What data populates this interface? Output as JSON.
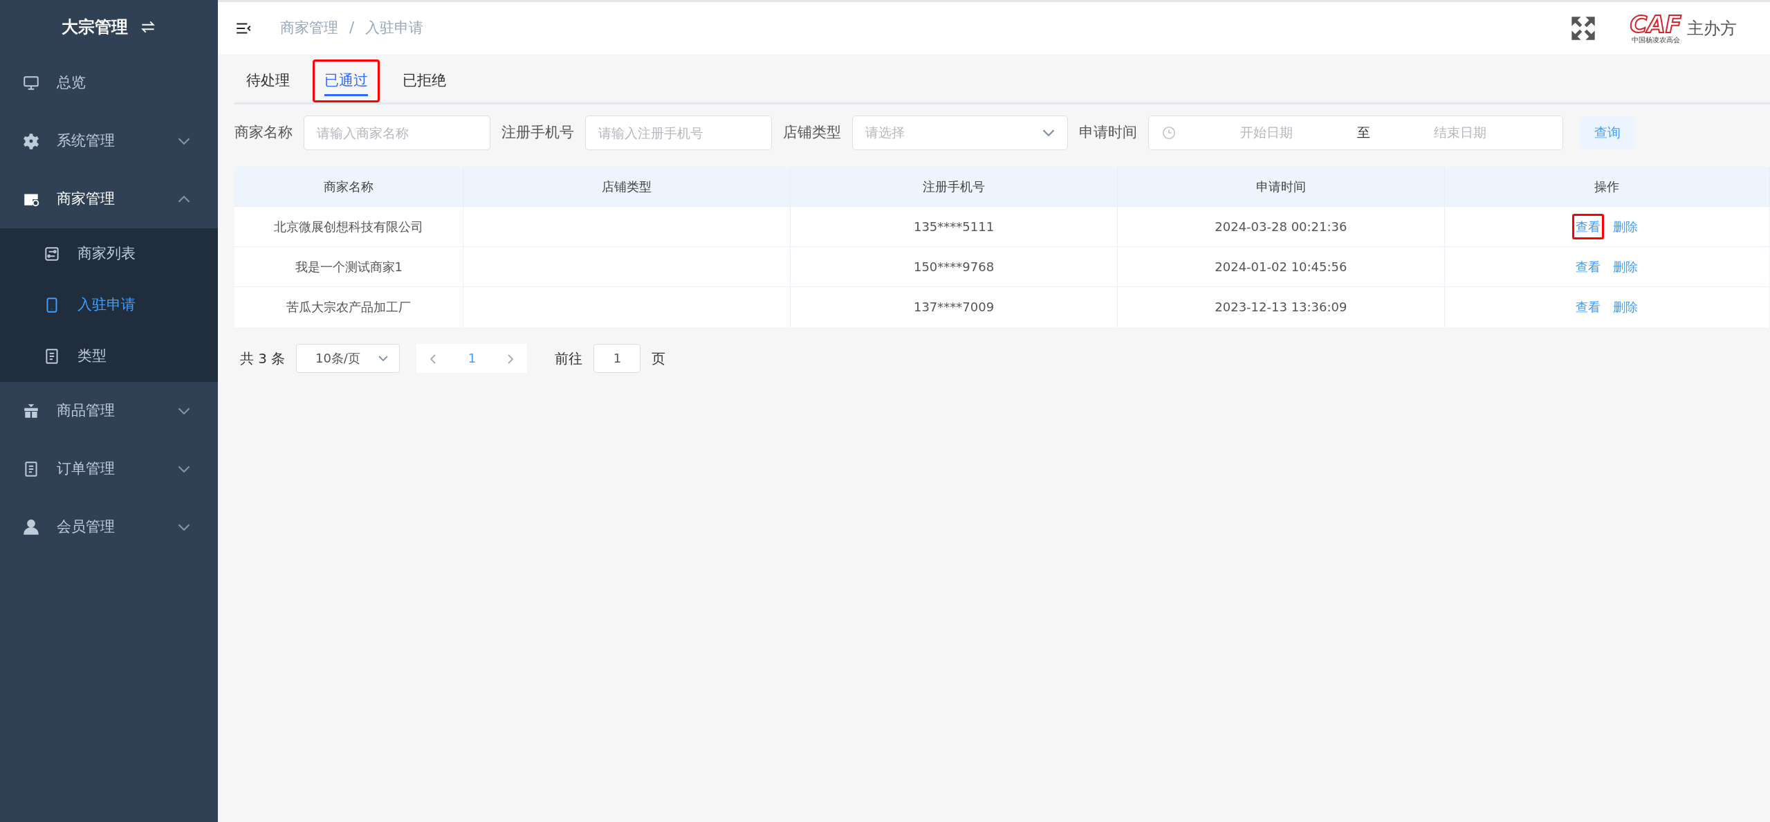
{
  "sidebar": {
    "title": "大宗管理",
    "items": [
      {
        "kind": "link",
        "label": "总览",
        "selected": false
      },
      {
        "kind": "group",
        "label": "系统管理",
        "expanded": false
      },
      {
        "kind": "group",
        "label": "商家管理",
        "expanded": true,
        "children": [
          {
            "label": "商家列表",
            "selected": false
          },
          {
            "label": "入驻申请",
            "selected": true
          },
          {
            "label": "类型",
            "selected": false
          }
        ]
      },
      {
        "kind": "group",
        "label": "商品管理",
        "expanded": false
      },
      {
        "kind": "group",
        "label": "订单管理",
        "expanded": false
      },
      {
        "kind": "group",
        "label": "会员管理",
        "expanded": false
      }
    ]
  },
  "header": {
    "breadcrumb": [
      "商家管理",
      "入驻申请"
    ],
    "separator": "/",
    "logo": "CAF",
    "logo_caption": "中国杨凌农高会",
    "organizer": "主办方"
  },
  "tabs": [
    {
      "label": "待处理",
      "selected": false,
      "highlighted": false
    },
    {
      "label": "已通过",
      "selected": true,
      "highlighted": true
    },
    {
      "label": "已拒绝",
      "selected": false,
      "highlighted": false
    }
  ],
  "filters": [
    {
      "kind": "text",
      "label": "商家名称",
      "placeholder": "请输入商家名称"
    },
    {
      "kind": "text",
      "label": "注册手机号",
      "placeholder": "请输入注册手机号"
    },
    {
      "kind": "select",
      "label": "店铺类型",
      "placeholder": "请选择"
    },
    {
      "kind": "daterange",
      "label": "申请时间",
      "start_placeholder": "开始日期",
      "separator": "至",
      "end_placeholder": "结束日期"
    }
  ],
  "search_button": "查询",
  "table": {
    "columns": [
      "商家名称",
      "店铺类型",
      "注册手机号",
      "申请时间",
      "操作"
    ],
    "rows": [
      {
        "cells": [
          "北京微展创想科技有限公司",
          "",
          "135****5111",
          "2024-03-28 00:21:36"
        ],
        "actions": [
          {
            "label": "查看",
            "highlighted": true
          },
          {
            "label": "删除",
            "highlighted": false
          }
        ]
      },
      {
        "cells": [
          "我是一个测试商家1",
          "",
          "150****9768",
          "2024-01-02 10:45:56"
        ],
        "actions": [
          {
            "label": "查看",
            "highlighted": false
          },
          {
            "label": "删除",
            "highlighted": false
          }
        ]
      },
      {
        "cells": [
          "苦瓜大宗农产品加工厂",
          "",
          "137****7009",
          "2023-12-13 13:36:09"
        ],
        "actions": [
          {
            "label": "查看",
            "highlighted": false
          },
          {
            "label": "删除",
            "highlighted": false
          }
        ]
      }
    ]
  },
  "pagination": {
    "total": "共 3 条",
    "page_size": "10条/页",
    "pages": [
      {
        "label": "1",
        "selected": true
      }
    ],
    "goto_label": "前往",
    "goto_value": "1",
    "goto_suffix": "页"
  }
}
